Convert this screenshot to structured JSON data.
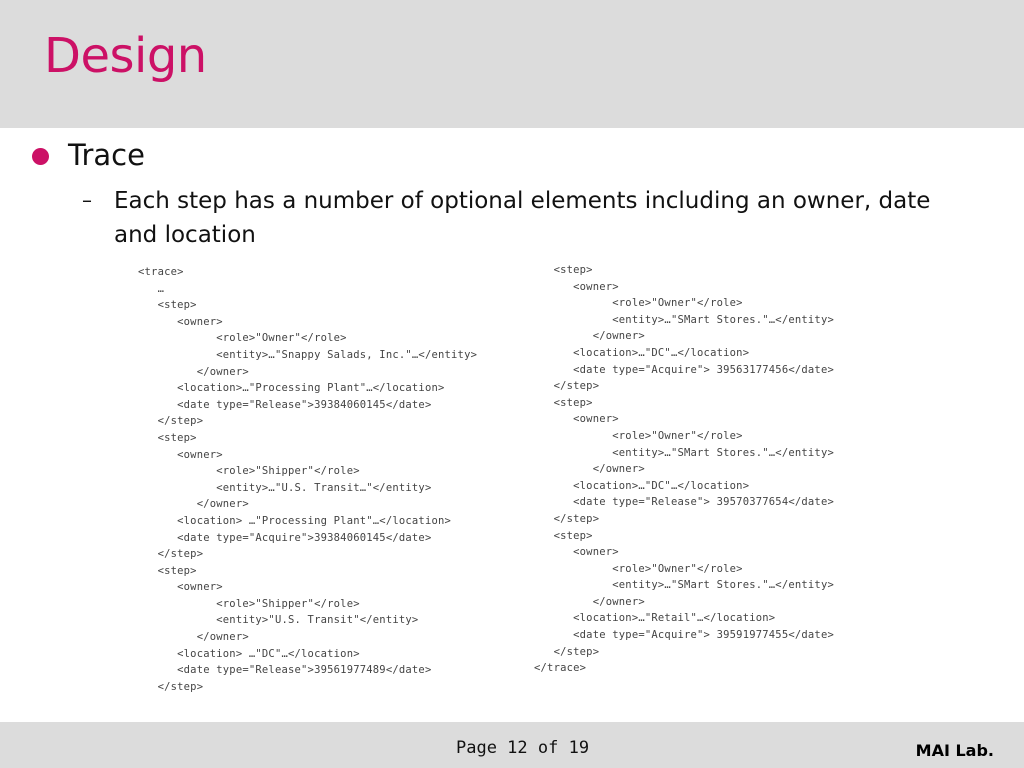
{
  "slide": {
    "title": "Design",
    "bullet": "Trace",
    "sub_dash": "–",
    "sub_text": "Each step has a number of optional elements including an owner, date and location"
  },
  "code_left": [
    "<trace>",
    "   …",
    "   <step>",
    "      <owner>",
    "            <role>\"Owner\"</role>",
    "            <entity>…\"Snappy Salads, Inc.\"…</entity>",
    "         </owner>",
    "      <location>…\"Processing Plant\"…</location>",
    "      <date type=\"Release\">39384060145</date>",
    "   </step>",
    "   <step>",
    "      <owner>",
    "            <role>\"Shipper\"</role>",
    "            <entity>…\"U.S. Transit…\"</entity>",
    "         </owner>",
    "      <location> …\"Processing Plant\"…</location>",
    "      <date type=\"Acquire\">39384060145</date>",
    "   </step>",
    "   <step>",
    "      <owner>",
    "            <role>\"Shipper\"</role>",
    "            <entity>\"U.S. Transit\"</entity>",
    "         </owner>",
    "      <location> …\"DC\"…</location>",
    "      <date type=\"Release\">39561977489</date>",
    "   </step>"
  ],
  "code_right": [
    "   <step>",
    "      <owner>",
    "            <role>\"Owner\"</role>",
    "            <entity>…\"SMart Stores.\"…</entity>",
    "         </owner>",
    "      <location>…\"DC\"…</location>",
    "      <date type=\"Acquire\"> 39563177456</date>",
    "   </step>",
    "   <step>",
    "      <owner>",
    "            <role>\"Owner\"</role>",
    "            <entity>…\"SMart Stores.\"…</entity>",
    "         </owner>",
    "      <location>…\"DC\"…</location>",
    "      <date type=\"Release\"> 39570377654</date>",
    "   </step>",
    "   <step>",
    "      <owner>",
    "            <role>\"Owner\"</role>",
    "            <entity>…\"SMart Stores.\"…</entity>",
    "         </owner>",
    "      <location>…\"Retail\"…</location>",
    "      <date type=\"Acquire\"> 39591977455</date>",
    "   </step>",
    "</trace>"
  ],
  "footer": {
    "page": "Page 12 of 19",
    "brand": "MAI Lab."
  }
}
